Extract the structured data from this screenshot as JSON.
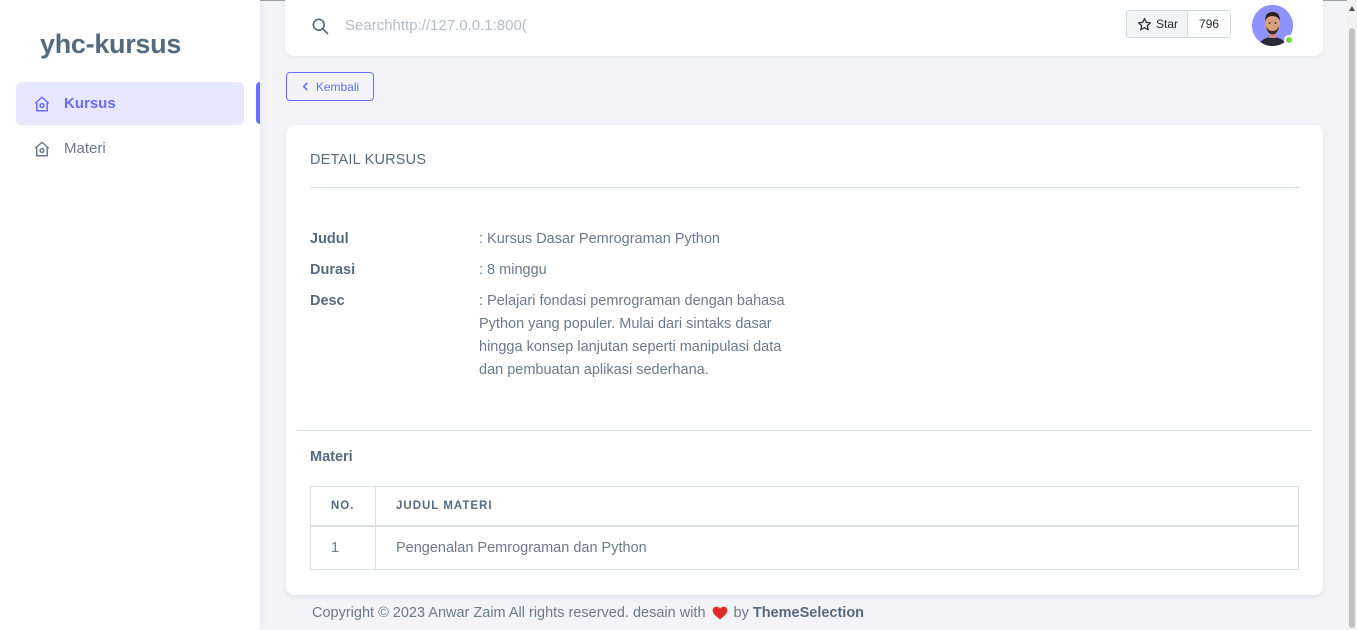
{
  "sidebar": {
    "brand": "yhc-kursus",
    "items": [
      {
        "label": "Kursus",
        "icon": "home-icon",
        "active": true
      },
      {
        "label": "Materi",
        "icon": "home-icon",
        "active": false
      }
    ]
  },
  "navbar": {
    "search_value": "Searchhttp://127.0.0.1:800(",
    "star_label": "Star",
    "star_count": "796"
  },
  "back_button": {
    "label": "Kembali",
    "icon": "chevron-left-icon"
  },
  "card": {
    "title": "DETAIL KURSUS",
    "details": [
      {
        "label": "Judul",
        "value": ": Kursus Dasar Pemrograman Python"
      },
      {
        "label": "Durasi",
        "value": ": 8 minggu"
      },
      {
        "label": "Desc",
        "value": ": Pelajari fondasi pemrograman dengan bahasa Python yang populer. Mulai dari sintaks dasar hingga konsep lanjutan seperti manipulasi data dan pembuatan aplikasi sederhana."
      }
    ],
    "materi_heading": "Materi",
    "table": {
      "headers": [
        "NO.",
        "JUDUL MATERI"
      ],
      "rows": [
        [
          "1",
          "Pengenalan Pemrograman dan Python"
        ]
      ]
    }
  },
  "footer": {
    "text": "Copyright © 2023 Anwar Zaim All rights reserved. desain with",
    "by": "by",
    "brand": "ThemeSelection",
    "heart_color": "#e02b2b"
  },
  "colors": {
    "primary": "#696cff",
    "active_bg": "#e7e7ff",
    "online": "#71dd37"
  }
}
